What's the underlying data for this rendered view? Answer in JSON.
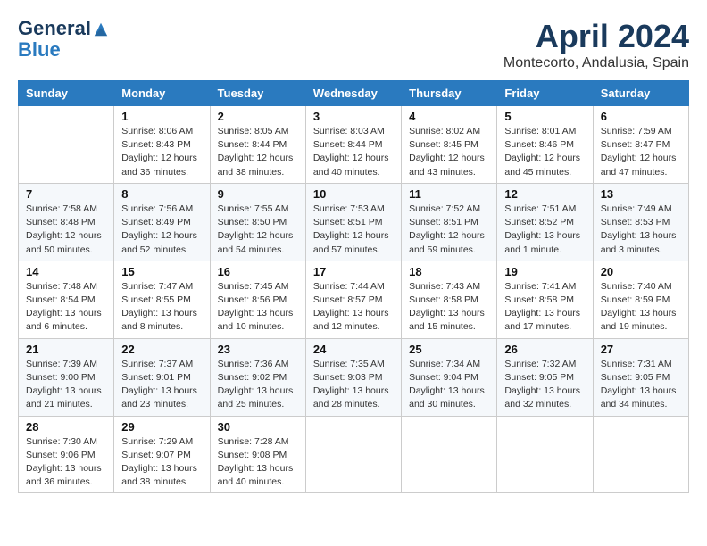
{
  "header": {
    "logo_line1": "General",
    "logo_line2": "Blue",
    "month_title": "April 2024",
    "location": "Montecorto, Andalusia, Spain"
  },
  "columns": [
    "Sunday",
    "Monday",
    "Tuesday",
    "Wednesday",
    "Thursday",
    "Friday",
    "Saturday"
  ],
  "weeks": [
    [
      {
        "day": "",
        "info": ""
      },
      {
        "day": "1",
        "info": "Sunrise: 8:06 AM\nSunset: 8:43 PM\nDaylight: 12 hours\nand 36 minutes."
      },
      {
        "day": "2",
        "info": "Sunrise: 8:05 AM\nSunset: 8:44 PM\nDaylight: 12 hours\nand 38 minutes."
      },
      {
        "day": "3",
        "info": "Sunrise: 8:03 AM\nSunset: 8:44 PM\nDaylight: 12 hours\nand 40 minutes."
      },
      {
        "day": "4",
        "info": "Sunrise: 8:02 AM\nSunset: 8:45 PM\nDaylight: 12 hours\nand 43 minutes."
      },
      {
        "day": "5",
        "info": "Sunrise: 8:01 AM\nSunset: 8:46 PM\nDaylight: 12 hours\nand 45 minutes."
      },
      {
        "day": "6",
        "info": "Sunrise: 7:59 AM\nSunset: 8:47 PM\nDaylight: 12 hours\nand 47 minutes."
      }
    ],
    [
      {
        "day": "7",
        "info": "Sunrise: 7:58 AM\nSunset: 8:48 PM\nDaylight: 12 hours\nand 50 minutes."
      },
      {
        "day": "8",
        "info": "Sunrise: 7:56 AM\nSunset: 8:49 PM\nDaylight: 12 hours\nand 52 minutes."
      },
      {
        "day": "9",
        "info": "Sunrise: 7:55 AM\nSunset: 8:50 PM\nDaylight: 12 hours\nand 54 minutes."
      },
      {
        "day": "10",
        "info": "Sunrise: 7:53 AM\nSunset: 8:51 PM\nDaylight: 12 hours\nand 57 minutes."
      },
      {
        "day": "11",
        "info": "Sunrise: 7:52 AM\nSunset: 8:51 PM\nDaylight: 12 hours\nand 59 minutes."
      },
      {
        "day": "12",
        "info": "Sunrise: 7:51 AM\nSunset: 8:52 PM\nDaylight: 13 hours\nand 1 minute."
      },
      {
        "day": "13",
        "info": "Sunrise: 7:49 AM\nSunset: 8:53 PM\nDaylight: 13 hours\nand 3 minutes."
      }
    ],
    [
      {
        "day": "14",
        "info": "Sunrise: 7:48 AM\nSunset: 8:54 PM\nDaylight: 13 hours\nand 6 minutes."
      },
      {
        "day": "15",
        "info": "Sunrise: 7:47 AM\nSunset: 8:55 PM\nDaylight: 13 hours\nand 8 minutes."
      },
      {
        "day": "16",
        "info": "Sunrise: 7:45 AM\nSunset: 8:56 PM\nDaylight: 13 hours\nand 10 minutes."
      },
      {
        "day": "17",
        "info": "Sunrise: 7:44 AM\nSunset: 8:57 PM\nDaylight: 13 hours\nand 12 minutes."
      },
      {
        "day": "18",
        "info": "Sunrise: 7:43 AM\nSunset: 8:58 PM\nDaylight: 13 hours\nand 15 minutes."
      },
      {
        "day": "19",
        "info": "Sunrise: 7:41 AM\nSunset: 8:58 PM\nDaylight: 13 hours\nand 17 minutes."
      },
      {
        "day": "20",
        "info": "Sunrise: 7:40 AM\nSunset: 8:59 PM\nDaylight: 13 hours\nand 19 minutes."
      }
    ],
    [
      {
        "day": "21",
        "info": "Sunrise: 7:39 AM\nSunset: 9:00 PM\nDaylight: 13 hours\nand 21 minutes."
      },
      {
        "day": "22",
        "info": "Sunrise: 7:37 AM\nSunset: 9:01 PM\nDaylight: 13 hours\nand 23 minutes."
      },
      {
        "day": "23",
        "info": "Sunrise: 7:36 AM\nSunset: 9:02 PM\nDaylight: 13 hours\nand 25 minutes."
      },
      {
        "day": "24",
        "info": "Sunrise: 7:35 AM\nSunset: 9:03 PM\nDaylight: 13 hours\nand 28 minutes."
      },
      {
        "day": "25",
        "info": "Sunrise: 7:34 AM\nSunset: 9:04 PM\nDaylight: 13 hours\nand 30 minutes."
      },
      {
        "day": "26",
        "info": "Sunrise: 7:32 AM\nSunset: 9:05 PM\nDaylight: 13 hours\nand 32 minutes."
      },
      {
        "day": "27",
        "info": "Sunrise: 7:31 AM\nSunset: 9:05 PM\nDaylight: 13 hours\nand 34 minutes."
      }
    ],
    [
      {
        "day": "28",
        "info": "Sunrise: 7:30 AM\nSunset: 9:06 PM\nDaylight: 13 hours\nand 36 minutes."
      },
      {
        "day": "29",
        "info": "Sunrise: 7:29 AM\nSunset: 9:07 PM\nDaylight: 13 hours\nand 38 minutes."
      },
      {
        "day": "30",
        "info": "Sunrise: 7:28 AM\nSunset: 9:08 PM\nDaylight: 13 hours\nand 40 minutes."
      },
      {
        "day": "",
        "info": ""
      },
      {
        "day": "",
        "info": ""
      },
      {
        "day": "",
        "info": ""
      },
      {
        "day": "",
        "info": ""
      }
    ]
  ]
}
